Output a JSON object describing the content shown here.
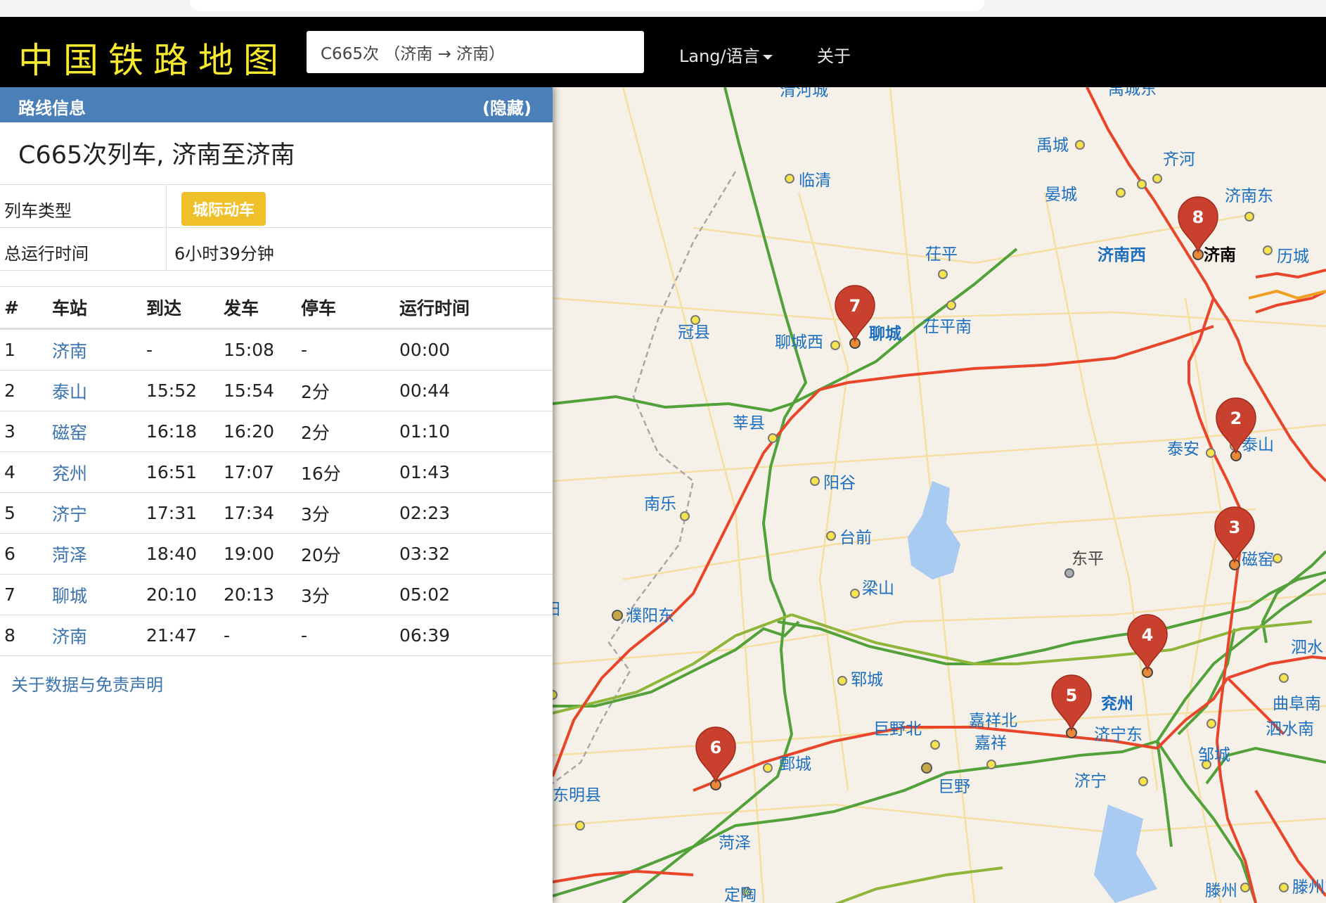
{
  "nav": {
    "brand": "中国铁路地图",
    "search_value": "C665次 （济南 → 济南）",
    "lang": "Lang/语言",
    "about": "关于"
  },
  "panel": {
    "header": "路线信息",
    "hide": "(隐藏)",
    "title": "C665次列车, 济南至济南",
    "type_label": "列车类型",
    "type_value": "城际动车",
    "time_label": "总运行时间",
    "time_value": "6小时39分钟",
    "columns": [
      "#",
      "车站",
      "到达",
      "发车",
      "停车",
      "运行时间"
    ],
    "rows": [
      [
        "1",
        "济南",
        "-",
        "15:08",
        "-",
        "00:00"
      ],
      [
        "2",
        "泰山",
        "15:52",
        "15:54",
        "2分",
        "00:44"
      ],
      [
        "3",
        "磁窑",
        "16:18",
        "16:20",
        "2分",
        "01:10"
      ],
      [
        "4",
        "兖州",
        "16:51",
        "17:07",
        "16分",
        "01:43"
      ],
      [
        "5",
        "济宁",
        "17:31",
        "17:34",
        "3分",
        "02:23"
      ],
      [
        "6",
        "菏泽",
        "18:40",
        "19:00",
        "20分",
        "03:32"
      ],
      [
        "7",
        "聊城",
        "20:10",
        "20:13",
        "3分",
        "05:02"
      ],
      [
        "8",
        "济南",
        "21:47",
        "-",
        "-",
        "06:39"
      ]
    ],
    "disclaimer": "关于数据与免责声明"
  },
  "map": {
    "labels": [
      "清河城",
      "禹城东",
      "禹城",
      "齐河",
      "晏城",
      "济南东",
      "济南西",
      "济南",
      "历城",
      "临清",
      "茌平",
      "茌平南",
      "冠县",
      "聊城西",
      "聊城",
      "莘县",
      "泰安",
      "泰山",
      "阳谷",
      "南乐",
      "台前",
      "东平",
      "磁窑",
      "梁山",
      "阳",
      "濮阳东",
      "泗水",
      "郓城",
      "曲阜南",
      "兖州",
      "巨野北",
      "嘉祥北",
      "济宁东",
      "泗水南",
      "鄄城",
      "嘉祥",
      "邹城",
      "巨野",
      "济宁",
      "东明县",
      "菏泽",
      "定陶",
      "滕州",
      "滕州东"
    ],
    "markers": [
      "8",
      "7",
      "2",
      "3",
      "4",
      "5",
      "6"
    ]
  }
}
